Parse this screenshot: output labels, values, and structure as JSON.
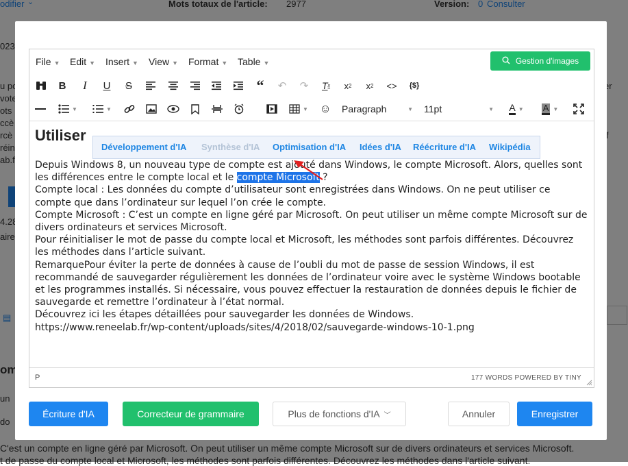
{
  "background": {
    "modifier_link": "odifier",
    "total_words_label": "Mots totaux de l'article:",
    "total_words_value": "2977",
    "version_label": "Version:",
    "version_value": "0",
    "consult_link": "Consulter",
    "left_fragments": [
      "023",
      "u po",
      "vote",
      "ots",
      "ccè",
      "rcè",
      "réin",
      "ab.fr",
      "4.28",
      "aire",
      "om",
      "un",
      "do"
    ],
    "right_fragments": [
      "er",
      "if"
    ],
    "bottom_line_1": "C'est un compte en ligne géré par Microsoft. On peut utiliser un même compte Microsoft sur de divers ordinateurs et services Microsoft.",
    "bottom_line_2": "t de passe du compte local et Microsoft, les méthodes sont parfois différentes. Découvrez les méthodes dans l'article suivant."
  },
  "menubar": {
    "items": [
      "File",
      "Edit",
      "Insert",
      "View",
      "Format",
      "Table"
    ],
    "image_button": "Gestion d'images"
  },
  "toolbar": {
    "block_format": "Paragraph",
    "font_size": "11pt"
  },
  "ai_menu": {
    "options": [
      "Développement d'IA",
      "Synthèse d'IA",
      "Optimisation d'IA",
      "Idées d'IA",
      "Réécriture d'IA",
      "Wikipédia"
    ]
  },
  "content": {
    "heading": "Utiliser",
    "p1_before": "Depuis Windows 8, un nouveau type de compte est ajouté dans Windows, le compte Microsoft. Alors, quelles sont les différences entre le compte local et le ",
    "p1_selected": "compte Microsoft",
    "p1_after": " ?",
    "p2": "Compte local : Les données du compte d’utilisateur sont enregistrées dans Windows. On ne peut utiliser ce compte que dans l’ordinateur sur lequel l’on crée le compte.",
    "p3": "Compte Microsoft : C’est un compte en ligne géré par Microsoft. On peut utiliser un même compte Microsoft sur de divers ordinateurs et services Microsoft.",
    "p4": "Pour réinitialiser le mot de passe du compte local et Microsoft, les méthodes sont parfois différentes. Découvrez les méthodes dans l’article suivant.",
    "p5": "RemarquePour éviter la perte de données à cause de l’oubli du mot de passe de session Windows, il est recommandé de sauvegarder régulièrement les données de l’ordinateur voire avec le système Windows bootable et les programmes installés. Si nécessaire, vous pouvez effectuer la restauration de données depuis le fichier de sauvegarde et remettre l’ordinateur à l’état normal.",
    "p6": "Découvrez ici les étapes détaillées pour sauvegarder les données de Windows.",
    "p7": "https://www.reneelab.fr/wp-content/uploads/sites/4/2018/02/sauvegarde-windows-10-1.png"
  },
  "status": {
    "path": "P",
    "word_count": "177 WORDS POWERED BY TINY"
  },
  "footer": {
    "ai_writing": "Écriture d'IA",
    "grammar": "Correcteur de grammaire",
    "more_ai": "Plus de fonctions d'IA",
    "cancel": "Annuler",
    "save": "Enregistrer"
  },
  "colors": {
    "primary_blue": "#1e86f0",
    "green": "#21c06d",
    "selection": "#1e74e8",
    "arrow": "#e02020"
  }
}
